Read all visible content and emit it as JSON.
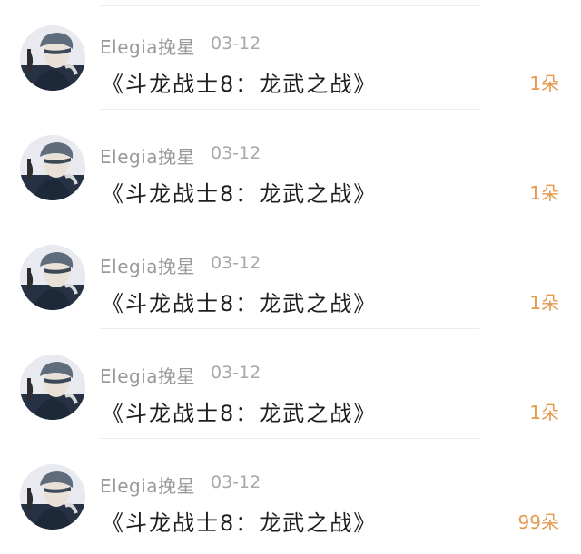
{
  "items": [
    {
      "username": "Elegia挽星",
      "date": "03-12",
      "title": "《斗龙战士8：龙武之战》",
      "count": "1朵"
    },
    {
      "username": "Elegia挽星",
      "date": "03-12",
      "title": "《斗龙战士8：龙武之战》",
      "count": "1朵"
    },
    {
      "username": "Elegia挽星",
      "date": "03-12",
      "title": "《斗龙战士8：龙武之战》",
      "count": "1朵"
    },
    {
      "username": "Elegia挽星",
      "date": "03-12",
      "title": "《斗龙战士8：龙武之战》",
      "count": "1朵"
    },
    {
      "username": "Elegia挽星",
      "date": "03-12",
      "title": "《斗龙战士8：龙武之战》",
      "count": "99朵"
    }
  ],
  "colors": {
    "username": "#9a9a9a",
    "date": "#a8a8a8",
    "title": "#1f1f1f",
    "count_accent": "#e39a4e",
    "divider": "#ececec"
  },
  "icons": {
    "avatar": "user-avatar-photo"
  }
}
